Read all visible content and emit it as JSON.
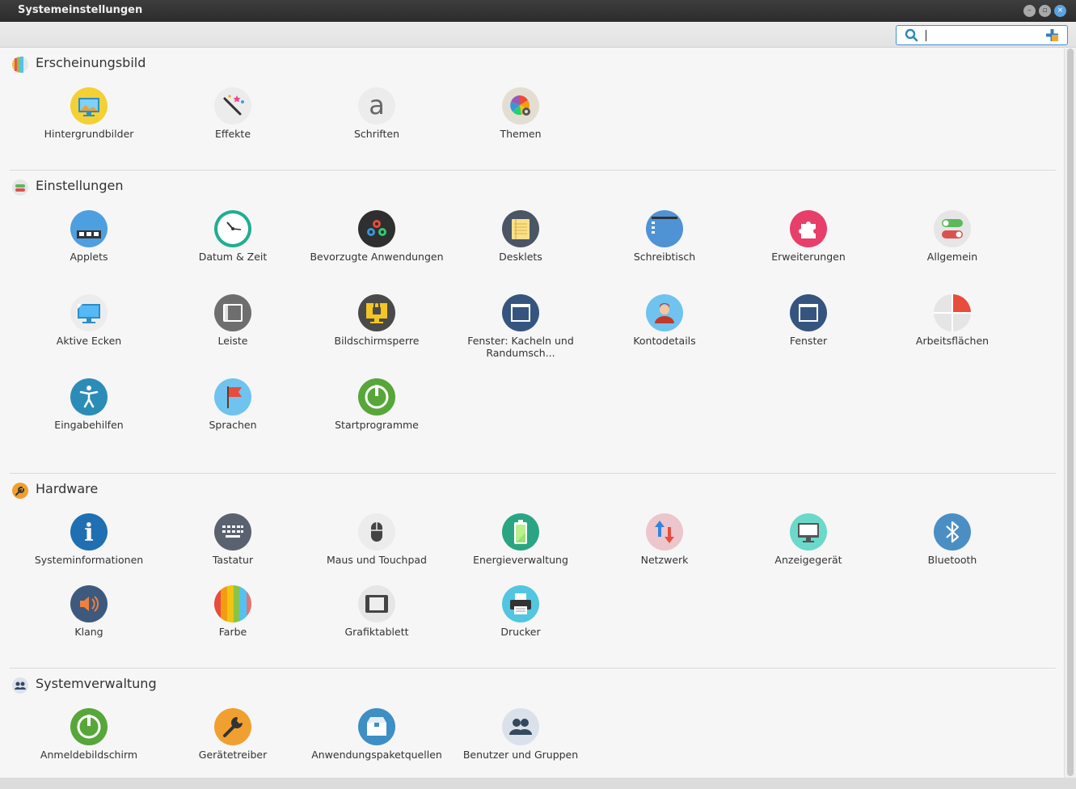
{
  "window": {
    "title": "Systemeinstellungen"
  },
  "search": {
    "value": "",
    "placeholder": ""
  },
  "sections": [
    {
      "title": "Erscheinungsbild",
      "icon": "appearance-icon",
      "items": [
        {
          "label": "Hintergrundbilder",
          "icon": "backgrounds-icon"
        },
        {
          "label": "Effekte",
          "icon": "effects-icon"
        },
        {
          "label": "Schriften",
          "icon": "fonts-icon"
        },
        {
          "label": "Themen",
          "icon": "themes-icon"
        }
      ]
    },
    {
      "title": "Einstellungen",
      "icon": "preferences-icon",
      "items": [
        {
          "label": "Applets",
          "icon": "applets-icon"
        },
        {
          "label": "Datum & Zeit",
          "icon": "clock-icon"
        },
        {
          "label": "Bevorzugte Anwendungen",
          "icon": "preferred-apps-icon"
        },
        {
          "label": "Desklets",
          "icon": "desklets-icon"
        },
        {
          "label": "Schreibtisch",
          "icon": "desktop-icon"
        },
        {
          "label": "Erweiterungen",
          "icon": "extensions-icon"
        },
        {
          "label": "Allgemein",
          "icon": "general-icon"
        },
        {
          "label": "Aktive Ecken",
          "icon": "hot-corners-icon"
        },
        {
          "label": "Leiste",
          "icon": "panel-icon"
        },
        {
          "label": "Bildschirmsperre",
          "icon": "screensaver-icon"
        },
        {
          "label": "Fenster: Kacheln und Randumsch...",
          "icon": "window-tiling-icon"
        },
        {
          "label": "Kontodetails",
          "icon": "account-icon"
        },
        {
          "label": "Fenster",
          "icon": "windows-icon"
        },
        {
          "label": "Arbeitsflächen",
          "icon": "workspaces-icon"
        },
        {
          "label": "Eingabehilfen",
          "icon": "accessibility-icon"
        },
        {
          "label": "Sprachen",
          "icon": "languages-icon"
        },
        {
          "label": "Startprogramme",
          "icon": "startup-icon"
        }
      ]
    },
    {
      "title": "Hardware",
      "icon": "hardware-icon",
      "items": [
        {
          "label": "Systeminformationen",
          "icon": "info-icon"
        },
        {
          "label": "Tastatur",
          "icon": "keyboard-icon"
        },
        {
          "label": "Maus und Touchpad",
          "icon": "mouse-icon"
        },
        {
          "label": "Energieverwaltung",
          "icon": "battery-icon"
        },
        {
          "label": "Netzwerk",
          "icon": "network-icon"
        },
        {
          "label": "Anzeigegerät",
          "icon": "display-icon"
        },
        {
          "label": "Bluetooth",
          "icon": "bluetooth-icon"
        },
        {
          "label": "Klang",
          "icon": "sound-icon"
        },
        {
          "label": "Farbe",
          "icon": "color-icon"
        },
        {
          "label": "Grafiktablett",
          "icon": "tablet-icon"
        },
        {
          "label": "Drucker",
          "icon": "printer-icon"
        }
      ]
    },
    {
      "title": "Systemverwaltung",
      "icon": "administration-icon",
      "items": [
        {
          "label": "Anmeldebildschirm",
          "icon": "login-icon"
        },
        {
          "label": "Gerätetreiber",
          "icon": "drivers-icon"
        },
        {
          "label": "Anwendungspaketquellen",
          "icon": "software-sources-icon"
        },
        {
          "label": "Benutzer und Gruppen",
          "icon": "users-icon"
        }
      ]
    }
  ]
}
